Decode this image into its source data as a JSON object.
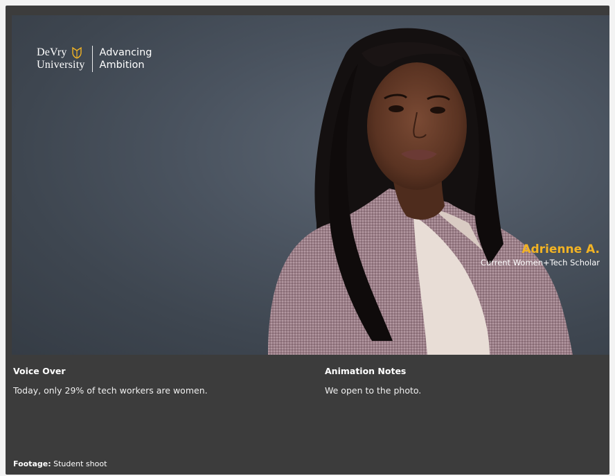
{
  "hero": {
    "logo": {
      "university_line1": "DeVry",
      "university_line2": "University",
      "tagline_line1": "Advancing",
      "tagline_line2": "Ambition",
      "shield_color": "#f2b324"
    },
    "caption": {
      "name": "Adrienne A.",
      "title": "Current Women+Tech Scholar",
      "name_color": "#f2b324"
    },
    "photo_icon": "portrait-photo"
  },
  "notes": {
    "voice_over": {
      "heading": "Voice Over",
      "text": "Today, only 29% of tech workers are women."
    },
    "animation_notes": {
      "heading": "Animation Notes",
      "text": "We open to the photo."
    }
  },
  "footage": {
    "label": "Footage:",
    "value": "Student shoot"
  },
  "colors": {
    "panel_bg": "#3c3c3c",
    "accent": "#f2b324"
  }
}
